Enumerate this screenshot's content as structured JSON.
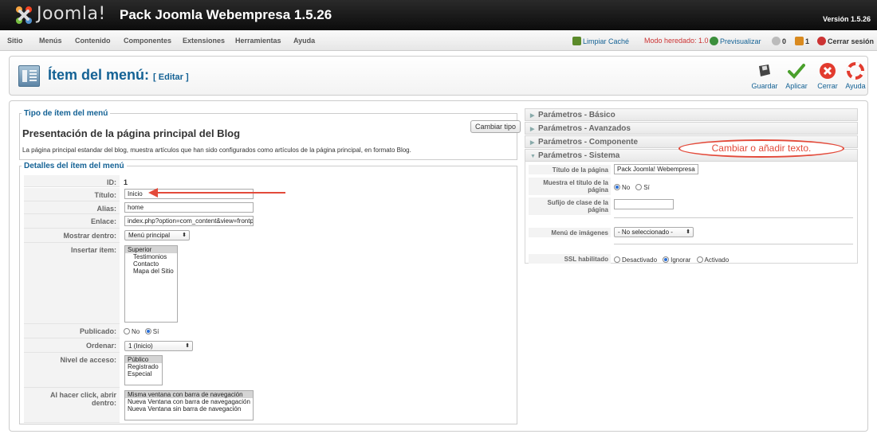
{
  "header": {
    "logo_text": "Joomla!",
    "site_title": "Pack Joomla Webempresa 1.5.26",
    "version": "Versión 1.5.26"
  },
  "menubar": {
    "items": [
      "Sitio",
      "Menús",
      "Contenido",
      "Componentes",
      "Extensiones",
      "Herramientas",
      "Ayuda"
    ],
    "clear_cache": "Limpiar Caché",
    "legacy_mode": "Modo heredado: 1.0",
    "preview": "Previsualizar",
    "messages_count": "0",
    "users_count": "1",
    "logout": "Cerrar sesión"
  },
  "toolbar": {
    "title": "Ítem del menú:",
    "subtitle": "[ Editar ]",
    "buttons": {
      "save": "Guardar",
      "apply": "Aplicar",
      "close": "Cerrar",
      "help": "Ayuda"
    }
  },
  "menu_type": {
    "legend": "Tipo de ítem del menú",
    "change_button": "Cambiar tipo",
    "title": "Presentación de la página principal del Blog",
    "description": "La página principal estandar del blog, muestra artículos que han sido configurados como artículos de la página principal, en formato Blog."
  },
  "details": {
    "legend": "Detalles del ítem del menú",
    "id_label": "ID:",
    "id_value": "1",
    "title_label": "Título:",
    "title_value": "Inicio",
    "alias_label": "Alias:",
    "alias_value": "home",
    "link_label": "Enlace:",
    "link_value": "index.php?option=com_content&view=frontpage",
    "show_in_label": "Mostrar dentro:",
    "show_in_value": "Menú principal",
    "insert_label": "Insertar ítem:",
    "insert_options": [
      "Superior",
      "Testimonios",
      "Contacto",
      "Mapa del Sitio"
    ],
    "published_label": "Publicado:",
    "no": "No",
    "yes": "Sí",
    "order_label": "Ordenar:",
    "order_value": "1 (Inicio)",
    "access_label": "Nivel de acceso:",
    "access_options": [
      "Público",
      "Registrado",
      "Especial"
    ],
    "click_label": "Al hacer click, abrir dentro:",
    "click_options": [
      "Misma ventana con barra de navegación",
      "Nueva Ventana con barra de navegagación",
      "Nueva Ventana sin barra de navegación"
    ]
  },
  "params": {
    "basic": "Parámetros - Básico",
    "advanced": "Parámetros - Avanzados",
    "component": "Parámetros - Componente",
    "system": "Parámetros - Sistema",
    "page_title_label": "Título de la página",
    "page_title_value": "Pack Joomla! Webempresa",
    "show_title_label": "Muestra el título de la página",
    "no": "No",
    "yes": "Sí",
    "suffix_label": "Sufijo de clase de la página",
    "menu_image_label": "Menú de imágenes",
    "menu_image_value": "- No seleccionado -",
    "ssl_label": "SSL habilitado",
    "ssl_options": [
      "Desactivado",
      "Ignorar",
      "Activado"
    ]
  },
  "annotation": {
    "callout": "Cambiar o añadir texto."
  }
}
